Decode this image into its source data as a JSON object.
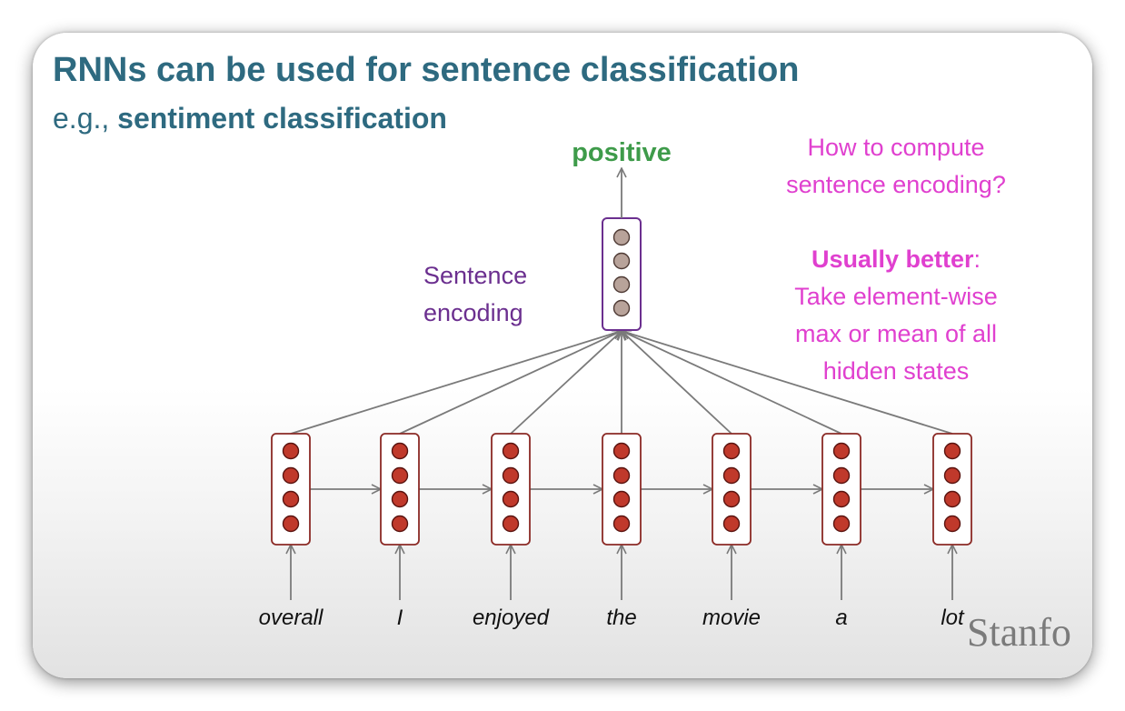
{
  "title": "RNNs can be used for sentence classification",
  "subtitle": {
    "prefix": "e.g., ",
    "emphasis": "sentiment classification"
  },
  "output_label": "positive",
  "encoding_label": {
    "line1": "Sentence",
    "line2": "encoding"
  },
  "note_question": {
    "line1": "How to compute",
    "line2": "sentence encoding?"
  },
  "note_answer": {
    "emphasis": "Usually better",
    "after_emphasis": ":",
    "line2": "Take element-wise",
    "line3": "max or mean of all",
    "line4": "hidden states"
  },
  "words": [
    "overall",
    "I",
    "enjoyed",
    "the",
    "movie",
    "a",
    "lot"
  ],
  "watermark": "Stanfo",
  "colors": {
    "title": "#2e6a80",
    "positive": "#3e9b4a",
    "encoding": "#6b2f8f",
    "notes": "#e040cf",
    "hidden_state_box": "#8b2a25",
    "hidden_state_dot": "#c0392b",
    "encoding_box": "#6b2f8f",
    "encoding_dot": "#b8a39a",
    "arrow": "#7a7a7a"
  }
}
